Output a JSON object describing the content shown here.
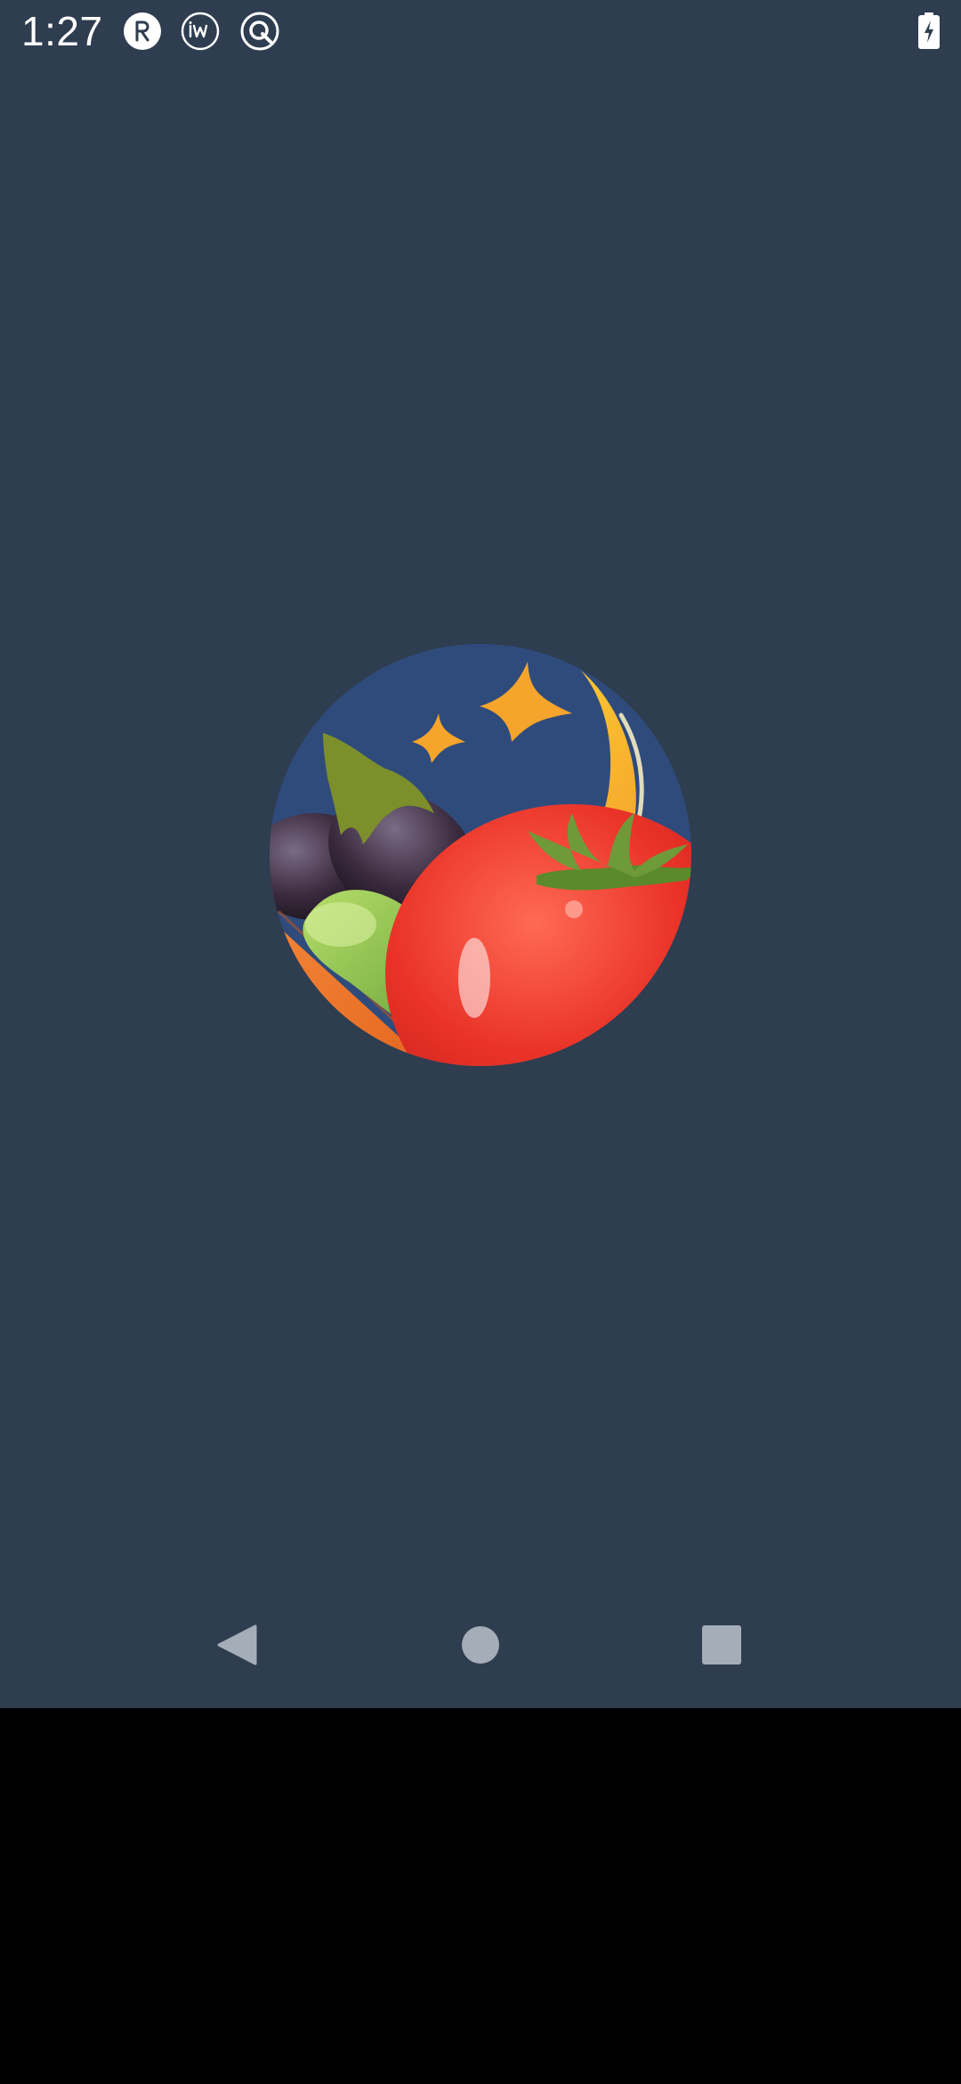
{
  "status_bar": {
    "time": "1:27",
    "notification_icons": [
      "r-badge-icon",
      "iw-badge-icon",
      "q-badge-icon"
    ],
    "battery_icon": "battery-charging-icon",
    "text_color": "#ffffff"
  },
  "splash": {
    "background_color": "#2e3d4f",
    "logo_icon": "vegetables-moon-logo-icon",
    "logo_colors": {
      "sky": "#2f4b7c",
      "moon": "#f5a42c",
      "tomato": "#e8332a",
      "eggplant": "#3b2a3a",
      "cucumber": "#8cc04a",
      "carrot": "#f07a2c"
    }
  },
  "navigation_bar": {
    "buttons": [
      "back-icon",
      "home-icon",
      "recents-icon"
    ],
    "button_color": "#a4adb8"
  }
}
